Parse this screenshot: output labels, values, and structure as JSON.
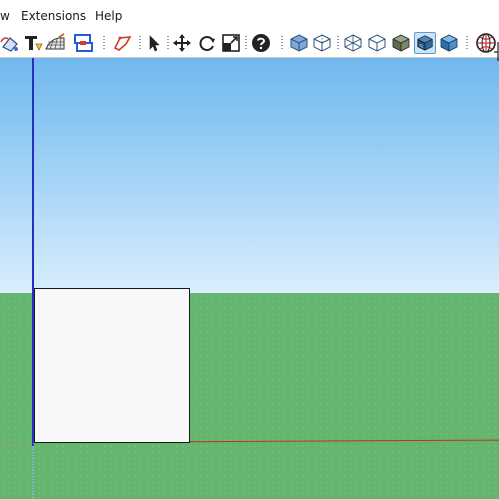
{
  "menubar": {
    "items": [
      {
        "label": "w"
      },
      {
        "label": "Extensions"
      },
      {
        "label": "Help"
      }
    ]
  },
  "toolbar": {
    "icons": [
      "paint-bucket-icon",
      "text-tool-icon",
      "sandbox-icon",
      "section-plane-icon",
      "polygon-icon",
      "select-icon",
      "move-icon",
      "rotate-icon",
      "scale-icon",
      "help-icon",
      "xray-style-icon",
      "back-edges-style-icon",
      "wireframe-style-icon",
      "hidden-line-style-icon",
      "shaded-style-icon",
      "shaded-textures-style-icon",
      "monochrome-style-icon",
      "geo-location-icon"
    ],
    "active": "shaded-textures-style-icon"
  },
  "colors": {
    "sky_top": "#6fb8ee",
    "sky_bottom": "#d9eefc",
    "ground": "#64b56e",
    "blue_axis": "#2231c4",
    "red_axis": "#b23a1f",
    "selection_blue": "#5a9bd5"
  }
}
